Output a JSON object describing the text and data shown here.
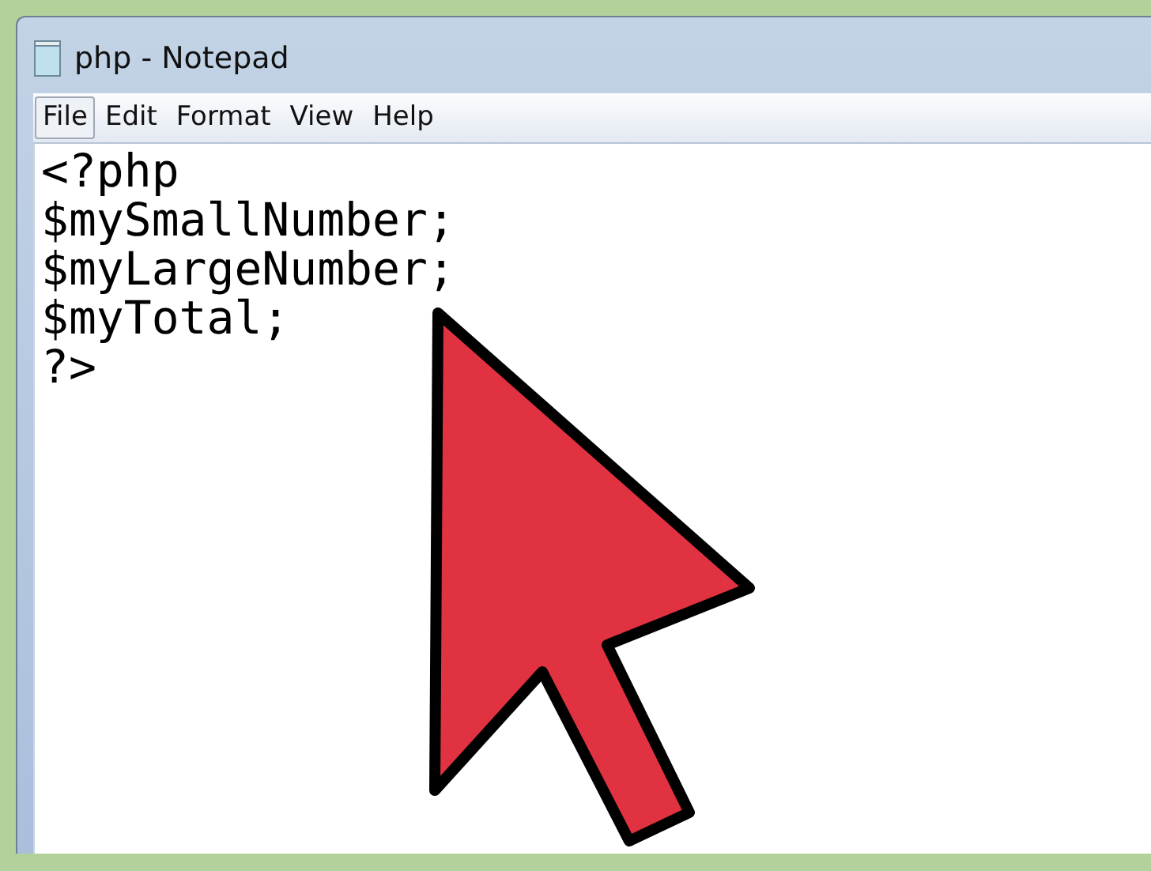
{
  "window": {
    "title": "php - Notepad"
  },
  "menu": [
    {
      "label": "File",
      "selected": true
    },
    {
      "label": "Edit",
      "selected": false
    },
    {
      "label": "Format",
      "selected": false
    },
    {
      "label": "View",
      "selected": false
    },
    {
      "label": "Help",
      "selected": false
    }
  ],
  "editor": {
    "lines": [
      "<?php",
      "$mySmallNumber;",
      "$myLargeNumber;",
      "$myTotal;",
      "?>"
    ]
  }
}
